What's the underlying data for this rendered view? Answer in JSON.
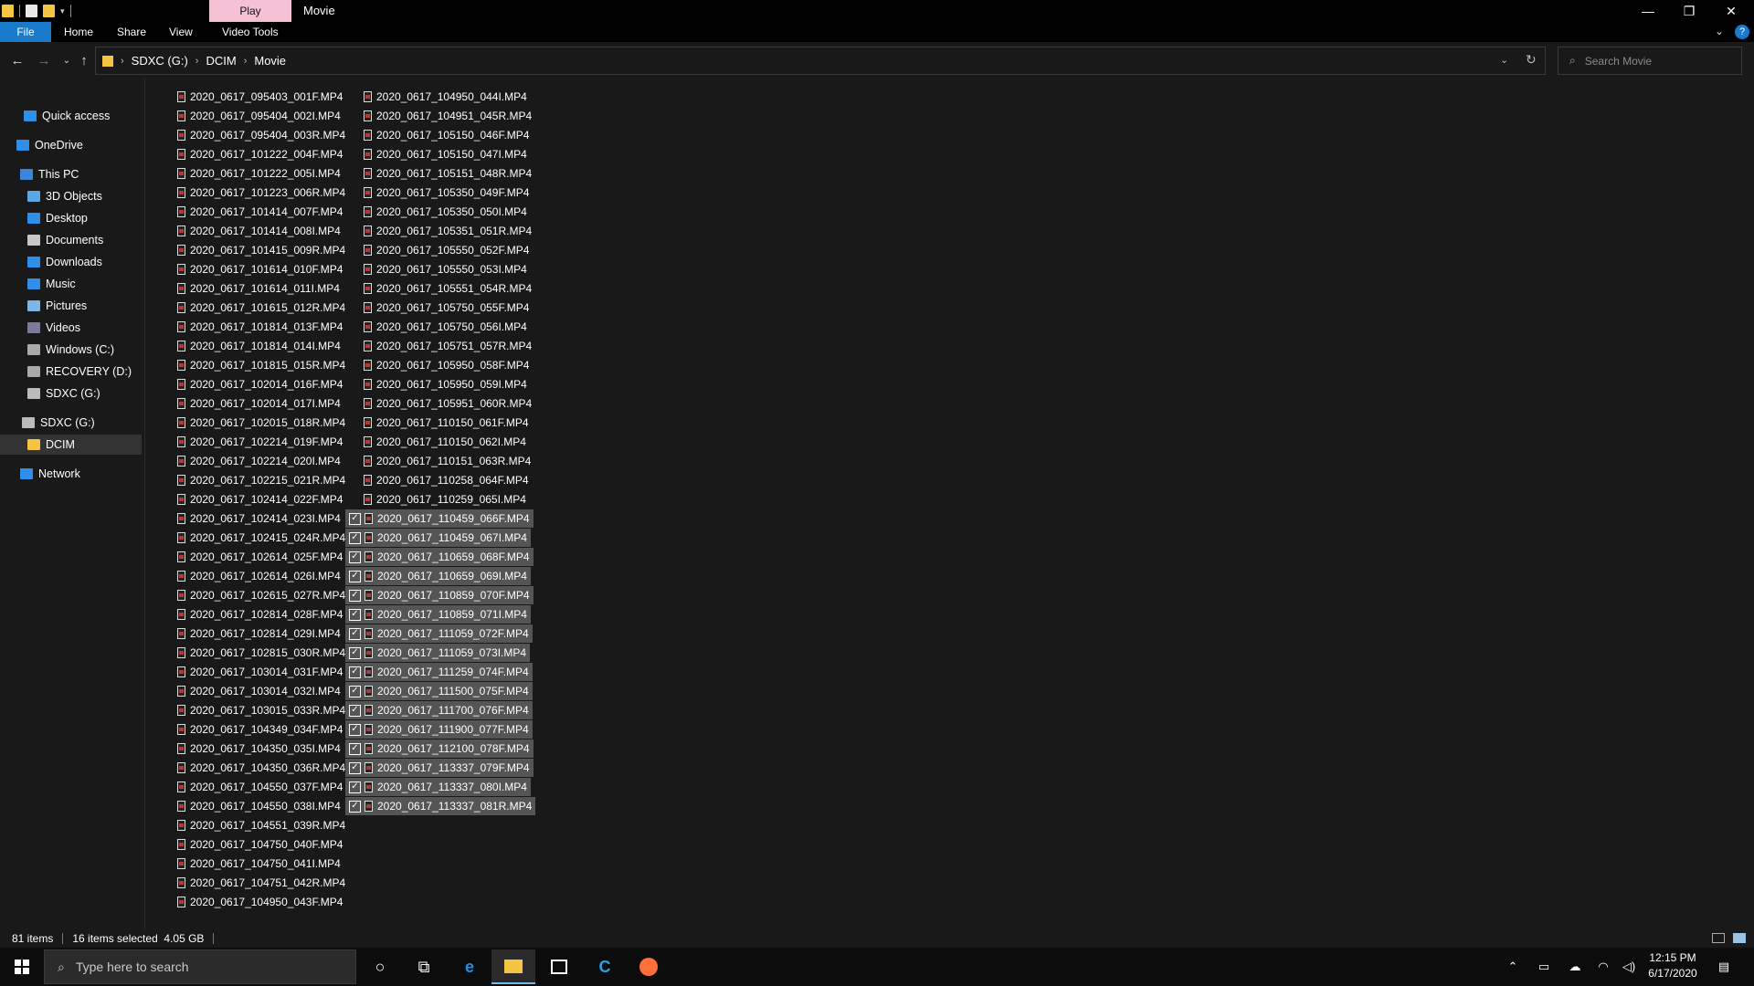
{
  "window": {
    "title": "Movie",
    "context_tab": "Play",
    "context_tab_color": "#f6c1d5",
    "accent": "#1979ca"
  },
  "ribbon": {
    "tabs": [
      "File",
      "Home",
      "Share",
      "View",
      "Video Tools"
    ]
  },
  "address": {
    "crumbs": [
      "SDXC (G:)",
      "DCIM",
      "Movie"
    ]
  },
  "search": {
    "placeholder": "Search Movie"
  },
  "nav": {
    "items": [
      {
        "label": "Quick access",
        "icon": "star-icon",
        "selected": false
      },
      {
        "label": "OneDrive",
        "icon": "cloud-icon",
        "selected": false
      },
      {
        "label": "This PC",
        "icon": "computer-icon",
        "selected": false
      },
      {
        "label": "3D Objects",
        "icon": "cube-icon",
        "selected": false
      },
      {
        "label": "Desktop",
        "icon": "desktop-icon",
        "selected": false
      },
      {
        "label": "Documents",
        "icon": "document-icon",
        "selected": false
      },
      {
        "label": "Downloads",
        "icon": "download-icon",
        "selected": false
      },
      {
        "label": "Music",
        "icon": "music-icon",
        "selected": false
      },
      {
        "label": "Pictures",
        "icon": "picture-icon",
        "selected": false
      },
      {
        "label": "Videos",
        "icon": "video-icon",
        "selected": false
      },
      {
        "label": "Windows (C:)",
        "icon": "drive-icon",
        "selected": false
      },
      {
        "label": "RECOVERY (D:)",
        "icon": "drive-icon",
        "selected": false
      },
      {
        "label": "SDXC (G:)",
        "icon": "sdcard-icon",
        "selected": false
      },
      {
        "label": "SDXC (G:)",
        "icon": "sdcard-icon",
        "selected": false
      },
      {
        "label": "DCIM",
        "icon": "folder-icon",
        "selected": true
      },
      {
        "label": "Network",
        "icon": "network-icon",
        "selected": false
      }
    ]
  },
  "files": {
    "column1": [
      "2020_0617_095403_001F.MP4",
      "2020_0617_095404_002I.MP4",
      "2020_0617_095404_003R.MP4",
      "2020_0617_101222_004F.MP4",
      "2020_0617_101222_005I.MP4",
      "2020_0617_101223_006R.MP4",
      "2020_0617_101414_007F.MP4",
      "2020_0617_101414_008I.MP4",
      "2020_0617_101415_009R.MP4",
      "2020_0617_101614_010F.MP4",
      "2020_0617_101614_011I.MP4",
      "2020_0617_101615_012R.MP4",
      "2020_0617_101814_013F.MP4",
      "2020_0617_101814_014I.MP4",
      "2020_0617_101815_015R.MP4",
      "2020_0617_102014_016F.MP4",
      "2020_0617_102014_017I.MP4",
      "2020_0617_102015_018R.MP4",
      "2020_0617_102214_019F.MP4",
      "2020_0617_102214_020I.MP4",
      "2020_0617_102215_021R.MP4",
      "2020_0617_102414_022F.MP4",
      "2020_0617_102414_023I.MP4",
      "2020_0617_102415_024R.MP4",
      "2020_0617_102614_025F.MP4",
      "2020_0617_102614_026I.MP4",
      "2020_0617_102615_027R.MP4",
      "2020_0617_102814_028F.MP4",
      "2020_0617_102814_029I.MP4",
      "2020_0617_102815_030R.MP4",
      "2020_0617_103014_031F.MP4",
      "2020_0617_103014_032I.MP4",
      "2020_0617_103015_033R.MP4",
      "2020_0617_104349_034F.MP4",
      "2020_0617_104350_035I.MP4",
      "2020_0617_104350_036R.MP4",
      "2020_0617_104550_037F.MP4",
      "2020_0617_104550_038I.MP4",
      "2020_0617_104551_039R.MP4",
      "2020_0617_104750_040F.MP4",
      "2020_0617_104750_041I.MP4",
      "2020_0617_104751_042R.MP4",
      "2020_0617_104950_043F.MP4"
    ],
    "column2": [
      "2020_0617_104950_044I.MP4",
      "2020_0617_104951_045R.MP4",
      "2020_0617_105150_046F.MP4",
      "2020_0617_105150_047I.MP4",
      "2020_0617_105151_048R.MP4",
      "2020_0617_105350_049F.MP4",
      "2020_0617_105350_050I.MP4",
      "2020_0617_105351_051R.MP4",
      "2020_0617_105550_052F.MP4",
      "2020_0617_105550_053I.MP4",
      "2020_0617_105551_054R.MP4",
      "2020_0617_105750_055F.MP4",
      "2020_0617_105750_056I.MP4",
      "2020_0617_105751_057R.MP4",
      "2020_0617_105950_058F.MP4",
      "2020_0617_105950_059I.MP4",
      "2020_0617_105951_060R.MP4",
      "2020_0617_110150_061F.MP4",
      "2020_0617_110150_062I.MP4",
      "2020_0617_110151_063R.MP4",
      "2020_0617_110258_064F.MP4",
      "2020_0617_110259_065I.MP4",
      "2020_0617_110459_066F.MP4",
      "2020_0617_110459_067I.MP4",
      "2020_0617_110659_068F.MP4",
      "2020_0617_110659_069I.MP4",
      "2020_0617_110859_070F.MP4",
      "2020_0617_110859_071I.MP4",
      "2020_0617_111059_072F.MP4",
      "2020_0617_111059_073I.MP4",
      "2020_0617_111259_074F.MP4",
      "2020_0617_111500_075F.MP4",
      "2020_0617_111700_076F.MP4",
      "2020_0617_111900_077F.MP4",
      "2020_0617_112100_078F.MP4",
      "2020_0617_113337_079F.MP4",
      "2020_0617_113337_080I.MP4",
      "2020_0617_113337_081R.MP4"
    ],
    "selected_in_column2": [
      "2020_0617_110459_066F.MP4",
      "2020_0617_110459_067I.MP4",
      "2020_0617_110659_068F.MP4",
      "2020_0617_110659_069I.MP4",
      "2020_0617_110859_070F.MP4",
      "2020_0617_110859_071I.MP4",
      "2020_0617_111059_072F.MP4",
      "2020_0617_111059_073I.MP4",
      "2020_0617_111259_074F.MP4",
      "2020_0617_111500_075F.MP4",
      "2020_0617_111700_076F.MP4",
      "2020_0617_111900_077F.MP4",
      "2020_0617_112100_078F.MP4",
      "2020_0617_113337_079F.MP4",
      "2020_0617_113337_080I.MP4",
      "2020_0617_113337_081R.MP4"
    ],
    "file_icon": "video-file-icon"
  },
  "status": {
    "count": "81 items",
    "selected": "16 items selected  4.05 GB"
  },
  "taskbar": {
    "search_placeholder": "Type here to search",
    "apps": [
      "cortana-icon",
      "task-view-icon",
      "edge-icon",
      "file-explorer-icon",
      "store-icon",
      "ccleaner-icon",
      "firefox-icon"
    ],
    "time": "12:15 PM",
    "date": "6/17/2020"
  }
}
